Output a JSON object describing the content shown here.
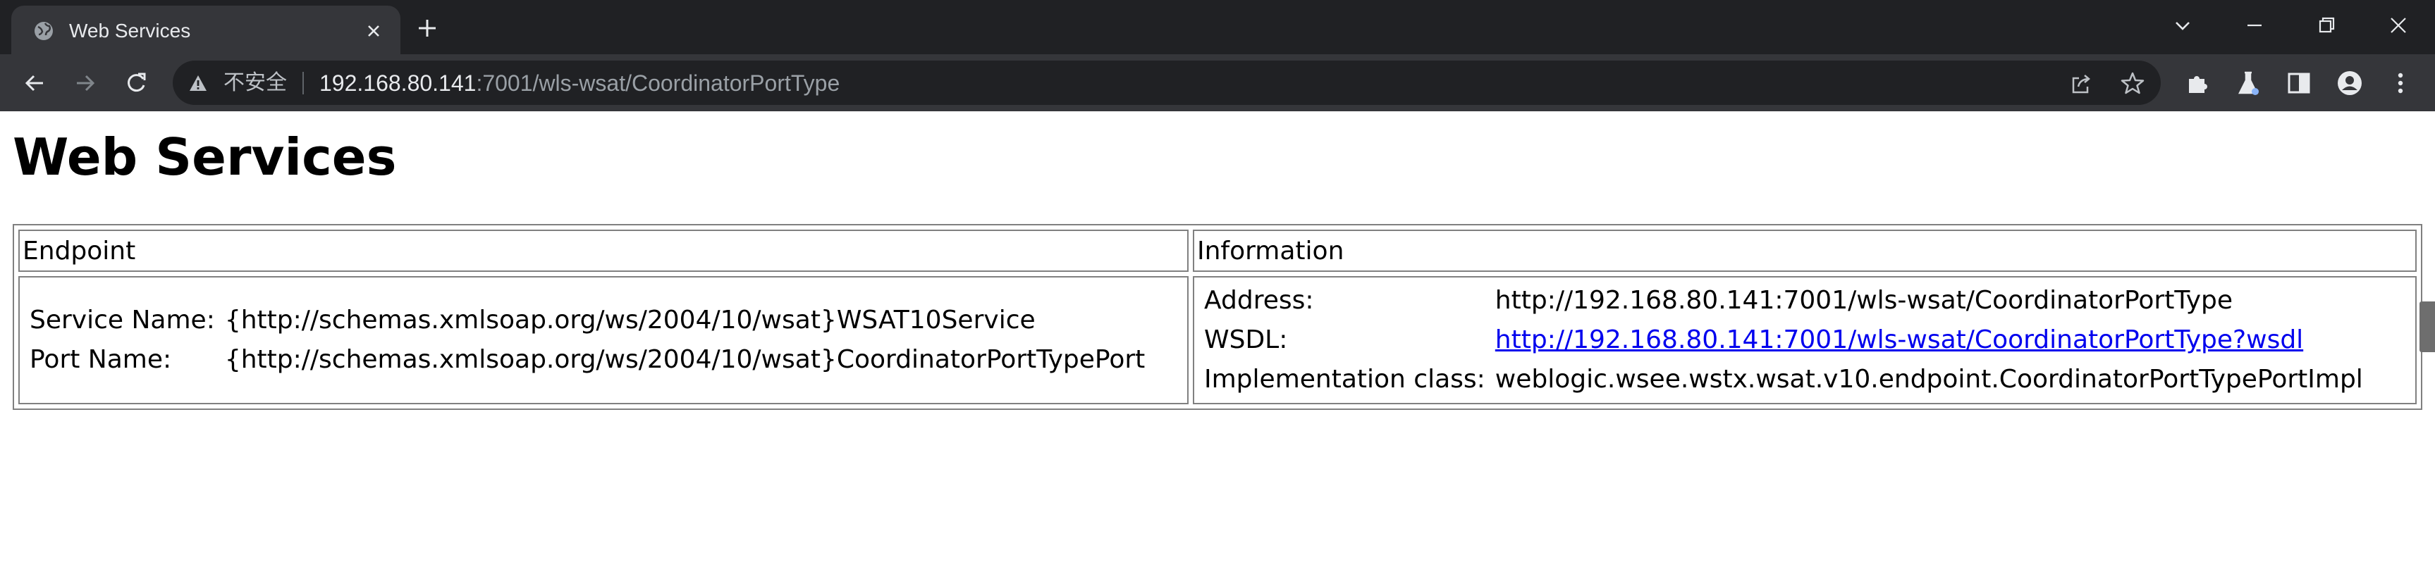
{
  "browser": {
    "tab": {
      "title": "Web Services"
    },
    "address_bar": {
      "security_label": "不安全",
      "url_host": "192.168.80.141",
      "url_path": ":7001/wls-wsat/CoordinatorPortType"
    }
  },
  "page": {
    "title": "Web Services",
    "table": {
      "headers": {
        "endpoint": "Endpoint",
        "information": "Information"
      },
      "endpoint": {
        "service_name_label": "Service Name:",
        "service_name_value": "{http://schemas.xmlsoap.org/ws/2004/10/wsat}WSAT10Service",
        "port_name_label": "Port Name:",
        "port_name_value": "{http://schemas.xmlsoap.org/ws/2004/10/wsat}CoordinatorPortTypePort"
      },
      "information": {
        "address_label": "Address:",
        "address_value": "http://192.168.80.141:7001/wls-wsat/CoordinatorPortType",
        "wsdl_label": "WSDL:",
        "wsdl_value": "http://192.168.80.141:7001/wls-wsat/CoordinatorPortType?wsdl",
        "impl_label": "Implementation class:",
        "impl_value": "weblogic.wsee.wstx.wsat.v10.endpoint.CoordinatorPortTypePortImpl"
      }
    }
  },
  "colors": {
    "tabstrip_bg": "#202124",
    "toolbar_bg": "#35363a",
    "link": "#0000ee"
  }
}
